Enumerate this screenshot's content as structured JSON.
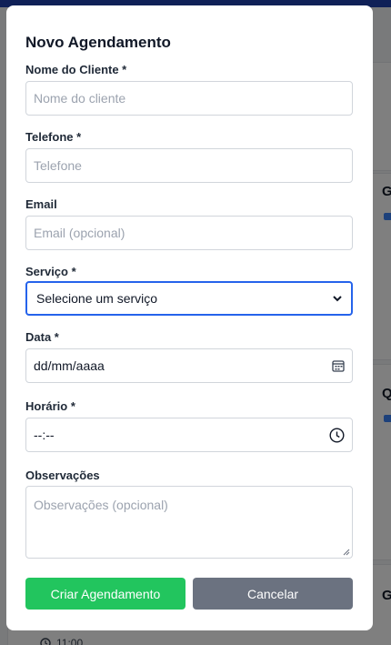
{
  "background": {
    "card_letters": [
      "G",
      "Q",
      "G"
    ],
    "time_text": "11:00"
  },
  "modal": {
    "title": "Novo Agendamento",
    "fields": {
      "client_name": {
        "label": "Nome do Cliente *",
        "placeholder": "Nome do cliente"
      },
      "phone": {
        "label": "Telefone *",
        "placeholder": "Telefone"
      },
      "email": {
        "label": "Email",
        "placeholder": "Email (opcional)"
      },
      "service": {
        "label": "Serviço *",
        "selected": "Selecione um serviço"
      },
      "date": {
        "label": "Data *",
        "value": "dd/mm/aaaa",
        "icon": "calendar-icon"
      },
      "time": {
        "label": "Horário *",
        "value": "--:--",
        "icon": "clock-icon"
      },
      "notes": {
        "label": "Observações",
        "placeholder": "Observações (opcional)"
      }
    },
    "buttons": {
      "submit": "Criar Agendamento",
      "cancel": "Cancelar"
    }
  },
  "colors": {
    "primary_green": "#22c55e",
    "secondary_gray": "#6b7280",
    "focus_blue": "#2563eb"
  }
}
